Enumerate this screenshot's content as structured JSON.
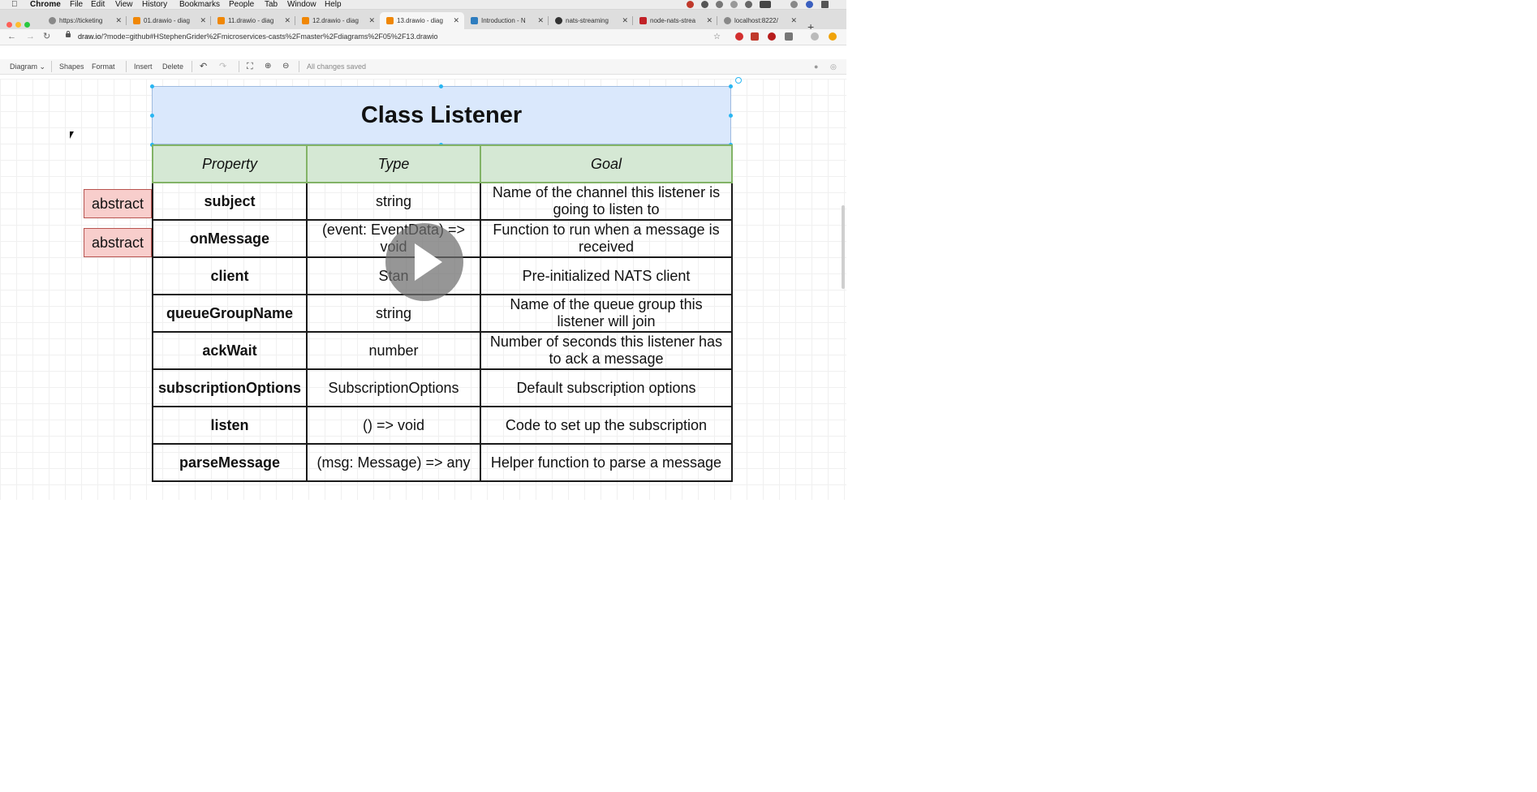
{
  "menubar": {
    "app": "Chrome",
    "items": [
      "File",
      "Edit",
      "View",
      "History",
      "Bookmarks",
      "People",
      "Tab",
      "Window",
      "Help"
    ]
  },
  "tabs": [
    {
      "title": "https://ticketing",
      "active": false
    },
    {
      "title": "01.drawio - diag",
      "active": false
    },
    {
      "title": "11.drawio - diag",
      "active": false
    },
    {
      "title": "12.drawio - diag",
      "active": false
    },
    {
      "title": "13.drawio - diag",
      "active": true
    },
    {
      "title": "Introduction - N",
      "active": false
    },
    {
      "title": "nats-streaming",
      "active": false
    },
    {
      "title": "node-nats-strea",
      "active": false
    },
    {
      "title": "localhost:8222/",
      "active": false
    }
  ],
  "address": {
    "host": "draw.io",
    "path": "/?mode=github#HStephenGrider%2Fmicroservices-casts%2Fmaster%2Fdiagrams%2F05%2F13.drawio"
  },
  "toolbar": {
    "diagram": "Diagram",
    "shapes": "Shapes",
    "format": "Format",
    "insert": "Insert",
    "delete": "Delete",
    "status": "All changes saved"
  },
  "diagram": {
    "title": "Class Listener",
    "headers": {
      "property": "Property",
      "type": "Type",
      "goal": "Goal"
    },
    "rows": [
      {
        "property": "subject",
        "type": "string",
        "goal": "Name of the channel this listener is going to listen to",
        "badge": "abstract"
      },
      {
        "property": "onMessage",
        "type": "(event: EventData) => void",
        "goal": "Function to run when a message is received",
        "badge": "abstract"
      },
      {
        "property": "client",
        "type": "Stan",
        "goal": "Pre-initialized NATS client"
      },
      {
        "property": "queueGroupName",
        "type": "string",
        "goal": "Name of the queue group this listener will join"
      },
      {
        "property": "ackWait",
        "type": "number",
        "goal": "Number of seconds this listener has to ack a message"
      },
      {
        "property": "subscriptionOptions",
        "type": "SubscriptionOptions",
        "goal": "Default subscription options"
      },
      {
        "property": "listen",
        "type": "() => void",
        "goal": "Code to set up the subscription"
      },
      {
        "property": "parseMessage",
        "type": "(msg: Message) => any",
        "goal": "Helper function to parse a message"
      }
    ]
  },
  "colors": {
    "title_fill": "#dae8fc",
    "header_fill": "#d5e8d4",
    "abstract_fill": "#f8cecc",
    "selection": "#29b6f2"
  }
}
